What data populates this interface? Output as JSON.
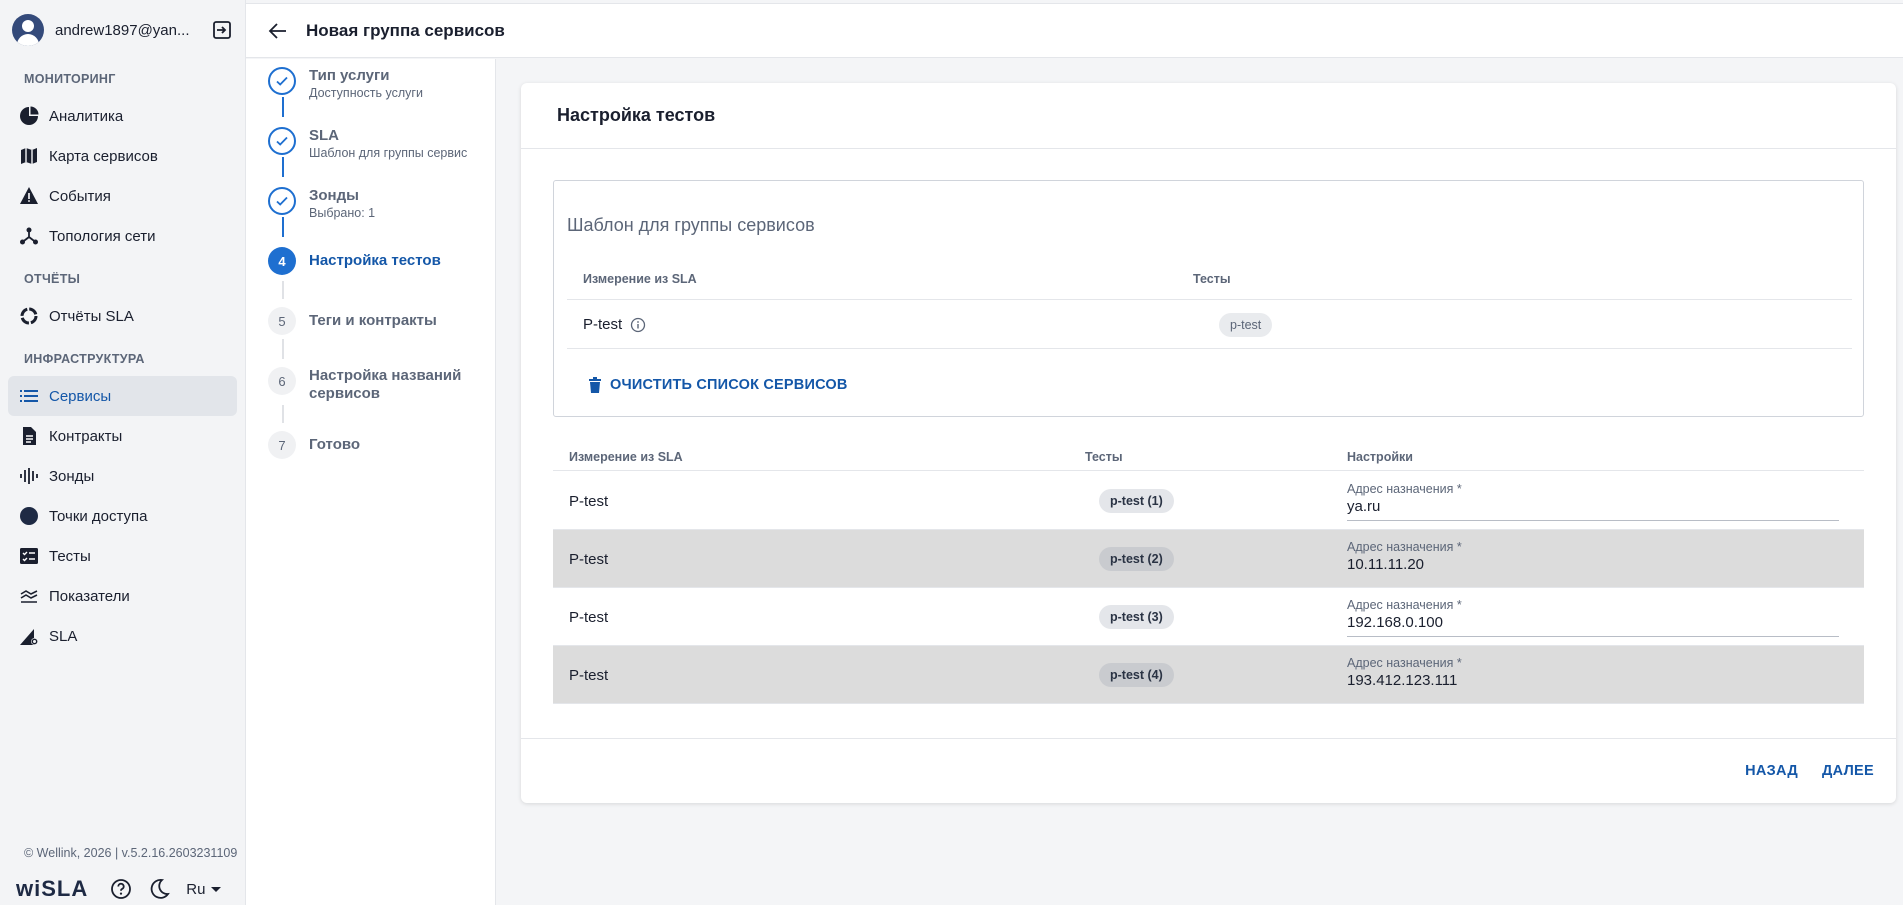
{
  "user": {
    "email": "andrew1897@yan..."
  },
  "sidebar": {
    "sections": [
      {
        "title": "МОНИТОРИНГ"
      },
      {
        "title": "ОТЧЁТЫ"
      },
      {
        "title": "ИНФРАСТРУКТУРА"
      }
    ],
    "monitoring": [
      {
        "label": "Аналитика",
        "icon": "pie-chart-icon"
      },
      {
        "label": "Карта сервисов",
        "icon": "map-icon"
      },
      {
        "label": "События",
        "icon": "warning-icon"
      },
      {
        "label": "Топология сети",
        "icon": "topology-icon"
      }
    ],
    "reports": [
      {
        "label": "Отчёты SLA",
        "icon": "donut-icon"
      }
    ],
    "infrastructure": [
      {
        "label": "Сервисы",
        "icon": "list-icon",
        "active": true
      },
      {
        "label": "Контракты",
        "icon": "document-icon"
      },
      {
        "label": "Зонды",
        "icon": "probe-icon"
      },
      {
        "label": "Точки доступа",
        "icon": "circle-icon"
      },
      {
        "label": "Тесты",
        "icon": "checklist-icon"
      },
      {
        "label": "Показатели",
        "icon": "metrics-icon"
      },
      {
        "label": "SLA",
        "icon": "sla-icon"
      }
    ],
    "copyright": "© Wellink, 2026 | v.5.2.16.2603231109",
    "brand": "wiSLA",
    "language": "Ru"
  },
  "header": {
    "title": "Новая группа сервисов"
  },
  "stepper": {
    "steps": [
      {
        "number": "",
        "title": "Тип услуги",
        "subtitle": "Доступность услуги",
        "state": "done"
      },
      {
        "number": "",
        "title": "SLA",
        "subtitle": "Шаблон для группы сервис",
        "state": "done"
      },
      {
        "number": "",
        "title": "Зонды",
        "subtitle": "Выбрано: 1",
        "state": "done"
      },
      {
        "number": "4",
        "title": "Настройка тестов",
        "subtitle": "",
        "state": "current"
      },
      {
        "number": "5",
        "title": "Теги и контракты",
        "subtitle": "",
        "state": "todo"
      },
      {
        "number": "6",
        "title": "Настройка названий сервисов",
        "subtitle": "",
        "state": "todo"
      },
      {
        "number": "7",
        "title": "Готово",
        "subtitle": "",
        "state": "todo"
      }
    ]
  },
  "main": {
    "title": "Настройка тестов",
    "template": {
      "title": "Шаблон для группы сервисов",
      "col_measure": "Измерение из SLA",
      "col_tests": "Тесты",
      "row": {
        "measure": "P-test",
        "test": "p-test"
      },
      "clear_button": "ОЧИСТИТЬ СПИСОК СЕРВИСОВ"
    },
    "table": {
      "col_measure": "Измерение из SLA",
      "col_tests": "Тесты",
      "col_settings": "Настройки",
      "rows": [
        {
          "measure": "P-test",
          "test": "p-test (1)",
          "field_label": "Адрес назначения *",
          "field_value": "ya.ru"
        },
        {
          "measure": "P-test",
          "test": "p-test (2)",
          "field_label": "Адрес назначения *",
          "field_value": "10.11.11.20"
        },
        {
          "measure": "P-test",
          "test": "p-test (3)",
          "field_label": "Адрес назначения *",
          "field_value": "192.168.0.100"
        },
        {
          "measure": "P-test",
          "test": "p-test (4)",
          "field_label": "Адрес назначения *",
          "field_value": "193.412.123.111"
        }
      ]
    },
    "footer": {
      "back": "НАЗАД",
      "next": "ДАЛЕЕ"
    }
  },
  "colors": {
    "accent": "#1e6fd0",
    "link": "#1457a8",
    "shaded_row": "#dcdcdc"
  }
}
